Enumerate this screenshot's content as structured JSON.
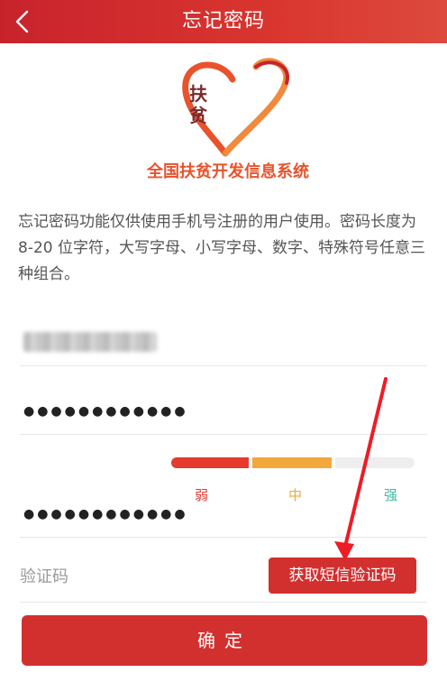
{
  "header": {
    "title": "忘记密码"
  },
  "icons": {
    "back": "chevron-left-icon",
    "logo": "heart-logo-icon"
  },
  "logo": {
    "mark": "扶贫",
    "name": "全国扶贫开发信息系统"
  },
  "description": "忘记密码功能仅供使用手机号注册的用户使用。密码长度为8-20 位字符，大写字母、小写字母、数字、特殊符号任意三种组合。",
  "form": {
    "password_mask": "●●●●●●●●●●●●",
    "confirm_password_mask": "●●●●●●●●●●●●",
    "strength": {
      "weak": "弱",
      "medium": "中",
      "strong": "强",
      "level": 2
    },
    "code_placeholder": "验证码",
    "sms_button": "获取短信验证码",
    "confirm_button": "确定"
  },
  "colors": {
    "primary": "#d2302f",
    "weak": "#e53a2e",
    "medium": "#f2a83a",
    "strong": "#3bb9a0"
  }
}
